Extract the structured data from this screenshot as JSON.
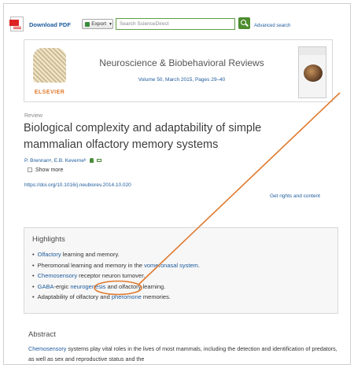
{
  "toolbar": {
    "download_pdf": "Download PDF",
    "export_label": "Export",
    "search_placeholder": "Search ScienceDirect",
    "advanced_search": "Advanced search"
  },
  "journal": {
    "logo_text": "ELSEVIER",
    "title": "Neuroscience & Biobehavioral Reviews",
    "volume": "Volume 50, March 2015, Pages 29–40"
  },
  "article": {
    "type": "Review",
    "title": "Biological complexity and adaptability of simple mammalian olfactory memory systems",
    "authors": "P. Brennanᵃ, E.B. Keverneᵇ",
    "show_more": "Show more",
    "doi": "https://doi.org/10.1016/j.neubiorev.2014.10.020",
    "rights": "Get rights and content"
  },
  "highlights": {
    "title": "Highlights",
    "items": [
      {
        "link": "Olfactory",
        "rest": " learning and memory."
      },
      {
        "pre": "Pheromonal learning and memory in the ",
        "link": "vomeronasal system",
        "post": "."
      },
      {
        "link": "Chemosensory",
        "rest": " receptor neuron turnover."
      },
      {
        "link": "GABA",
        "mid": "-ergic ",
        "link2": "neurogenesis",
        "post": " and olfactory learning."
      },
      {
        "pre": "Adaptability of olfactory and ",
        "link": "pheromone",
        "post": " memories."
      }
    ]
  },
  "abstract": {
    "title": "Abstract",
    "link": "Chemosensory",
    "text": " systems play vital roles in the lives of most mammals, including the detection and identification of predators, as well as sex and reproductive status and the"
  },
  "colors": {
    "link": "#1d5a9b",
    "annotation": "#e07a2e",
    "search_green": "#4d8c2f"
  }
}
